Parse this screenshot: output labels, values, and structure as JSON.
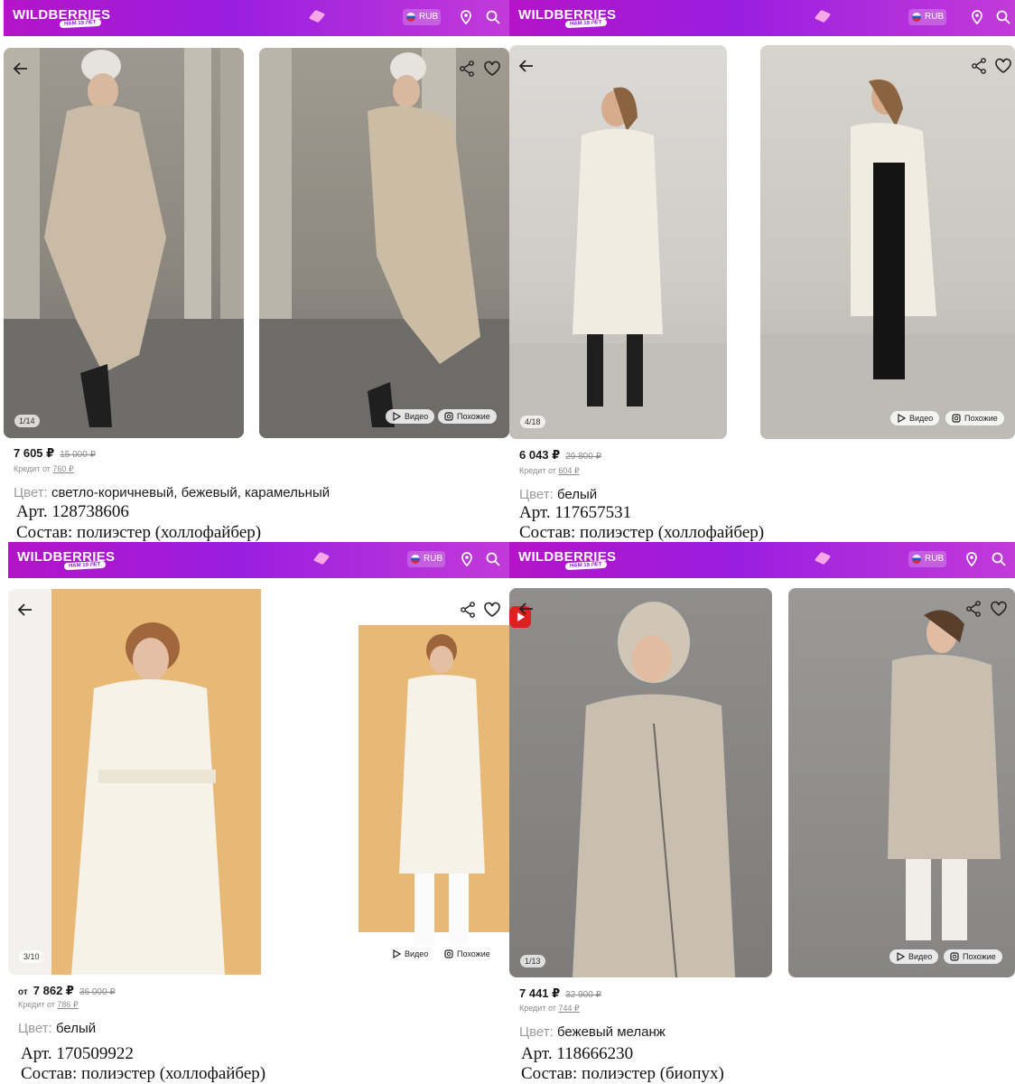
{
  "brand": {
    "logo_text": "WILDBERRIES",
    "badge_text": "НАМ 19 ЛЕТ",
    "currency": "RUB",
    "accent": "#b414c8"
  },
  "icons": [
    "back-arrow-icon",
    "share-icon",
    "heart-icon",
    "location-icon",
    "search-icon",
    "play-icon",
    "similar-icon"
  ],
  "labels": {
    "video": "Видео",
    "similar": "Похожие",
    "color_label": "Цвет:",
    "credit_prefix": "Кредит от"
  },
  "products": [
    {
      "counter": "1/14",
      "price_prefix": "",
      "price": "7 605 ₽",
      "old_price": "15 000 ₽",
      "credit": "760 ₽",
      "color": "светло-коричневый, бежевый, карамельный",
      "article": "Арт. 128738606",
      "composition": "Состав: полиэстер (холлофайбер)"
    },
    {
      "counter": "4/18",
      "price_prefix": "",
      "price": "6 043 ₽",
      "old_price": "29 800 ₽",
      "credit": "604 ₽",
      "color": "белый",
      "article": "Арт. 117657531",
      "composition": "Состав: полиэстер (холлофайбер)"
    },
    {
      "counter": "3/10",
      "price_prefix": "от",
      "price": "7 862 ₽",
      "old_price": "36 000 ₽",
      "credit": "786 ₽",
      "color": "белый",
      "article": "Арт. 170509922",
      "composition": "Состав: полиэстер (холлофайбер)"
    },
    {
      "counter": "1/13",
      "price_prefix": "",
      "price": "7 441 ₽",
      "old_price": "32 900 ₽",
      "credit": "744 ₽",
      "color": "бежевый меланж",
      "article": "Арт. 118666230",
      "composition": "Состав: полиэстер (биопух)"
    }
  ]
}
